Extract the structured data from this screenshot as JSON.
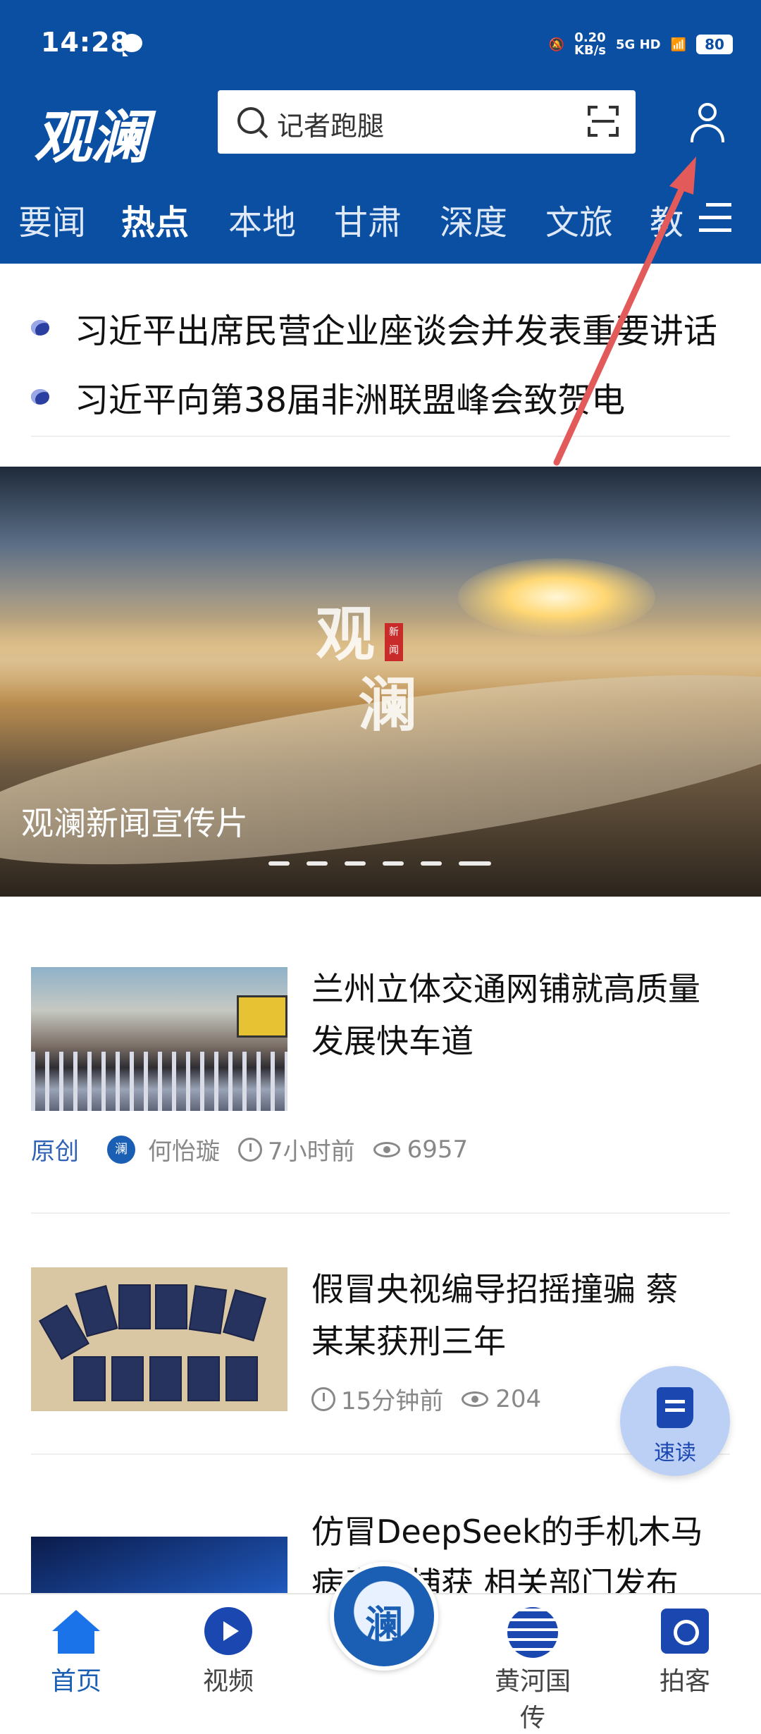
{
  "status": {
    "time": "14:28",
    "speed_value": "0.20",
    "speed_unit": "KB/s",
    "network": "5G HD",
    "battery": "80"
  },
  "header": {
    "logo": "观澜",
    "search_placeholder": "记者跑腿"
  },
  "tabs": [
    "要闻",
    "热点",
    "本地",
    "甘肃",
    "深度",
    "文旅",
    "教"
  ],
  "headlines": [
    "习近平出席民营企业座谈会并发表重要讲话",
    "习近平向第38届非洲联盟峰会致贺电"
  ],
  "banner": {
    "caption": "观澜新闻宣传片",
    "watermark_1": "观",
    "watermark_2": "澜",
    "seal": "新闻",
    "slide_count": 6,
    "active_slide": 6
  },
  "articles": [
    {
      "title_1": "兰州立体交通网铺就高质量",
      "title_2": "发展快车道",
      "badge": "原创",
      "avatar": "澜",
      "author": "何怡璇",
      "time": "7小时前",
      "views": "6957"
    },
    {
      "title_1": "假冒央视编导招摇撞骗 蔡",
      "title_2": "某某获刑三年",
      "time": "15分钟前",
      "views": "204"
    },
    {
      "title_1": "仿冒DeepSeek的手机木马",
      "title_2": "病毒被捕获 相关部门发布"
    }
  ],
  "float_button": {
    "label": "速读"
  },
  "bottom_nav": {
    "home": "首页",
    "video": "视频",
    "center": "澜",
    "yellow_river": "黄河国传",
    "paike": "拍客"
  },
  "colors": {
    "brand": "#0b4fa3",
    "accent": "#1a5fb4",
    "arrow": "#e35a5a"
  }
}
